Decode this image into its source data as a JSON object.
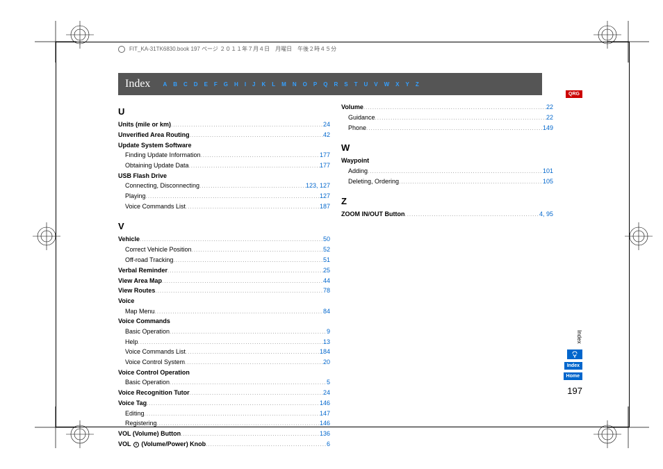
{
  "header_stamp": "FIT_KA-31TK6830.book  197 ページ  ２０１１年７月４日　月曜日　午後２時４５分",
  "index_title": "Index",
  "alphabet": [
    "A",
    "B",
    "C",
    "D",
    "E",
    "F",
    "G",
    "H",
    "I",
    "J",
    "K",
    "L",
    "M",
    "N",
    "O",
    "P",
    "Q",
    "R",
    "S",
    "T",
    "U",
    "V",
    "W",
    "X",
    "Y",
    "Z"
  ],
  "right_tabs": {
    "qrg": "QRG",
    "side_index": "Index",
    "index": "Index",
    "home": "Home"
  },
  "page_number": "197",
  "sections": {
    "U": [
      {
        "term": "Units (mile or km)",
        "page": "24",
        "bold": true
      },
      {
        "term": "Unverified Area Routing",
        "page": "42",
        "bold": true
      },
      {
        "term": "Update System Software",
        "bold": true,
        "noref": true
      },
      {
        "term": "Finding Update Information",
        "page": "177",
        "sub": true
      },
      {
        "term": "Obtaining Update Data",
        "page": "177",
        "sub": true
      },
      {
        "term": "USB Flash Drive",
        "bold": true,
        "noref": true
      },
      {
        "term": "Connecting, Disconnecting",
        "page": "123, 127",
        "sub": true
      },
      {
        "term": "Playing",
        "page": "127",
        "sub": true
      },
      {
        "term": "Voice Commands List",
        "page": "187",
        "sub": true
      }
    ],
    "V": [
      {
        "term": "Vehicle",
        "page": "50",
        "bold": true
      },
      {
        "term": "Correct Vehicle Position",
        "page": "52",
        "sub": true
      },
      {
        "term": "Off-road Tracking",
        "page": "51",
        "sub": true
      },
      {
        "term": "Verbal Reminder",
        "page": "25",
        "bold": true
      },
      {
        "term": "View Area Map",
        "page": "44",
        "bold": true
      },
      {
        "term": "View Routes",
        "page": "78",
        "bold": true
      },
      {
        "term": "Voice",
        "bold": true,
        "noref": true
      },
      {
        "term": "Map Menu",
        "page": "84",
        "sub": true
      },
      {
        "term": "Voice Commands",
        "bold": true,
        "noref": true
      },
      {
        "term": "Basic Operation",
        "page": "9",
        "sub": true
      },
      {
        "term": "Help",
        "page": "13",
        "sub": true
      },
      {
        "term": "Voice Commands List",
        "page": "184",
        "sub": true
      },
      {
        "term": "Voice Control System",
        "page": "20",
        "sub": true
      },
      {
        "term": "Voice Control Operation",
        "bold": true,
        "noref": true
      },
      {
        "term": "Basic Operation",
        "page": "5",
        "sub": true
      },
      {
        "term": "Voice Recognition Tutor",
        "page": "24",
        "bold": true
      },
      {
        "term": "Voice Tag",
        "page": "146",
        "bold": true
      },
      {
        "term": "Editing",
        "page": "147",
        "sub": true
      },
      {
        "term": "Registering",
        "page": "146",
        "sub": true
      },
      {
        "term": "VOL (Volume) Button",
        "page": "136",
        "bold": true
      },
      {
        "term": "VOL ⏻ (Volume/Power) Knob",
        "page": "6",
        "bold": true,
        "powericon": true
      }
    ],
    "Vol": [
      {
        "term": "Volume",
        "page": "22",
        "bold": true
      },
      {
        "term": "Guidance",
        "page": "22",
        "sub": true
      },
      {
        "term": "Phone",
        "page": "149",
        "sub": true
      }
    ],
    "W": [
      {
        "term": "Waypoint",
        "bold": true,
        "noref": true
      },
      {
        "term": "Adding",
        "page": "101",
        "sub": true
      },
      {
        "term": "Deleting, Ordering",
        "page": "105",
        "sub": true
      }
    ],
    "Z": [
      {
        "term": "ZOOM IN/OUT Button",
        "page": "4, 95",
        "bold": true
      }
    ]
  }
}
